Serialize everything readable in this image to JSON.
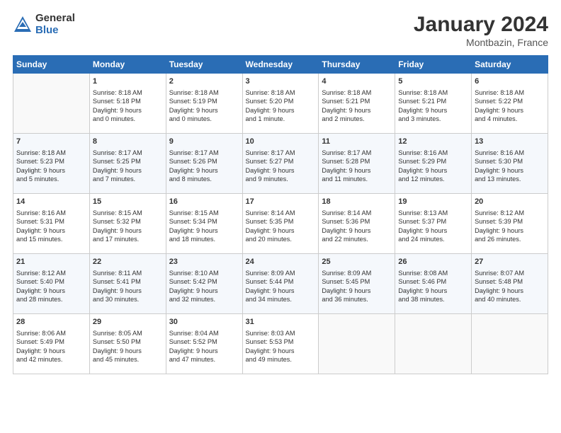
{
  "header": {
    "logo_general": "General",
    "logo_blue": "Blue",
    "title": "January 2024",
    "subtitle": "Montbazin, France"
  },
  "days_of_week": [
    "Sunday",
    "Monday",
    "Tuesday",
    "Wednesday",
    "Thursday",
    "Friday",
    "Saturday"
  ],
  "weeks": [
    [
      {
        "day": "",
        "info": ""
      },
      {
        "day": "1",
        "info": "Sunrise: 8:18 AM\nSunset: 5:18 PM\nDaylight: 9 hours\nand 0 minutes."
      },
      {
        "day": "2",
        "info": "Sunrise: 8:18 AM\nSunset: 5:19 PM\nDaylight: 9 hours\nand 0 minutes."
      },
      {
        "day": "3",
        "info": "Sunrise: 8:18 AM\nSunset: 5:20 PM\nDaylight: 9 hours\nand 1 minute."
      },
      {
        "day": "4",
        "info": "Sunrise: 8:18 AM\nSunset: 5:21 PM\nDaylight: 9 hours\nand 2 minutes."
      },
      {
        "day": "5",
        "info": "Sunrise: 8:18 AM\nSunset: 5:21 PM\nDaylight: 9 hours\nand 3 minutes."
      },
      {
        "day": "6",
        "info": "Sunrise: 8:18 AM\nSunset: 5:22 PM\nDaylight: 9 hours\nand 4 minutes."
      }
    ],
    [
      {
        "day": "7",
        "info": "Sunrise: 8:18 AM\nSunset: 5:23 PM\nDaylight: 9 hours\nand 5 minutes."
      },
      {
        "day": "8",
        "info": "Sunrise: 8:17 AM\nSunset: 5:25 PM\nDaylight: 9 hours\nand 7 minutes."
      },
      {
        "day": "9",
        "info": "Sunrise: 8:17 AM\nSunset: 5:26 PM\nDaylight: 9 hours\nand 8 minutes."
      },
      {
        "day": "10",
        "info": "Sunrise: 8:17 AM\nSunset: 5:27 PM\nDaylight: 9 hours\nand 9 minutes."
      },
      {
        "day": "11",
        "info": "Sunrise: 8:17 AM\nSunset: 5:28 PM\nDaylight: 9 hours\nand 11 minutes."
      },
      {
        "day": "12",
        "info": "Sunrise: 8:16 AM\nSunset: 5:29 PM\nDaylight: 9 hours\nand 12 minutes."
      },
      {
        "day": "13",
        "info": "Sunrise: 8:16 AM\nSunset: 5:30 PM\nDaylight: 9 hours\nand 13 minutes."
      }
    ],
    [
      {
        "day": "14",
        "info": "Sunrise: 8:16 AM\nSunset: 5:31 PM\nDaylight: 9 hours\nand 15 minutes."
      },
      {
        "day": "15",
        "info": "Sunrise: 8:15 AM\nSunset: 5:32 PM\nDaylight: 9 hours\nand 17 minutes."
      },
      {
        "day": "16",
        "info": "Sunrise: 8:15 AM\nSunset: 5:34 PM\nDaylight: 9 hours\nand 18 minutes."
      },
      {
        "day": "17",
        "info": "Sunrise: 8:14 AM\nSunset: 5:35 PM\nDaylight: 9 hours\nand 20 minutes."
      },
      {
        "day": "18",
        "info": "Sunrise: 8:14 AM\nSunset: 5:36 PM\nDaylight: 9 hours\nand 22 minutes."
      },
      {
        "day": "19",
        "info": "Sunrise: 8:13 AM\nSunset: 5:37 PM\nDaylight: 9 hours\nand 24 minutes."
      },
      {
        "day": "20",
        "info": "Sunrise: 8:12 AM\nSunset: 5:39 PM\nDaylight: 9 hours\nand 26 minutes."
      }
    ],
    [
      {
        "day": "21",
        "info": "Sunrise: 8:12 AM\nSunset: 5:40 PM\nDaylight: 9 hours\nand 28 minutes."
      },
      {
        "day": "22",
        "info": "Sunrise: 8:11 AM\nSunset: 5:41 PM\nDaylight: 9 hours\nand 30 minutes."
      },
      {
        "day": "23",
        "info": "Sunrise: 8:10 AM\nSunset: 5:42 PM\nDaylight: 9 hours\nand 32 minutes."
      },
      {
        "day": "24",
        "info": "Sunrise: 8:09 AM\nSunset: 5:44 PM\nDaylight: 9 hours\nand 34 minutes."
      },
      {
        "day": "25",
        "info": "Sunrise: 8:09 AM\nSunset: 5:45 PM\nDaylight: 9 hours\nand 36 minutes."
      },
      {
        "day": "26",
        "info": "Sunrise: 8:08 AM\nSunset: 5:46 PM\nDaylight: 9 hours\nand 38 minutes."
      },
      {
        "day": "27",
        "info": "Sunrise: 8:07 AM\nSunset: 5:48 PM\nDaylight: 9 hours\nand 40 minutes."
      }
    ],
    [
      {
        "day": "28",
        "info": "Sunrise: 8:06 AM\nSunset: 5:49 PM\nDaylight: 9 hours\nand 42 minutes."
      },
      {
        "day": "29",
        "info": "Sunrise: 8:05 AM\nSunset: 5:50 PM\nDaylight: 9 hours\nand 45 minutes."
      },
      {
        "day": "30",
        "info": "Sunrise: 8:04 AM\nSunset: 5:52 PM\nDaylight: 9 hours\nand 47 minutes."
      },
      {
        "day": "31",
        "info": "Sunrise: 8:03 AM\nSunset: 5:53 PM\nDaylight: 9 hours\nand 49 minutes."
      },
      {
        "day": "",
        "info": ""
      },
      {
        "day": "",
        "info": ""
      },
      {
        "day": "",
        "info": ""
      }
    ]
  ]
}
